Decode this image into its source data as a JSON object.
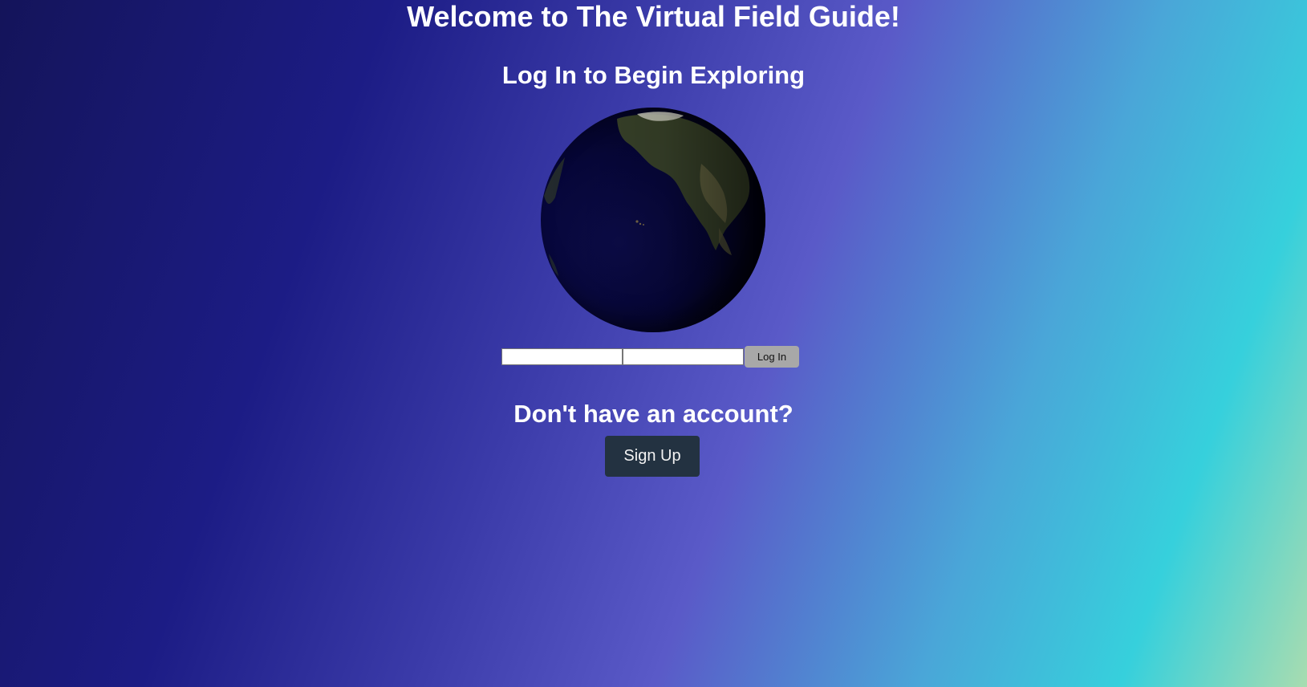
{
  "header": {
    "title": "Welcome to The Virtual Field Guide!",
    "subtitle": "Log In to Begin Exploring"
  },
  "login": {
    "username_value": "",
    "password_value": "",
    "button_label": "Log In"
  },
  "signup": {
    "prompt": "Don't have an account?",
    "button_label": "Sign Up"
  },
  "colors": {
    "login_button": "#a8a8a8",
    "signup_button": "#233241"
  },
  "icons": {
    "globe": "earth-globe"
  }
}
